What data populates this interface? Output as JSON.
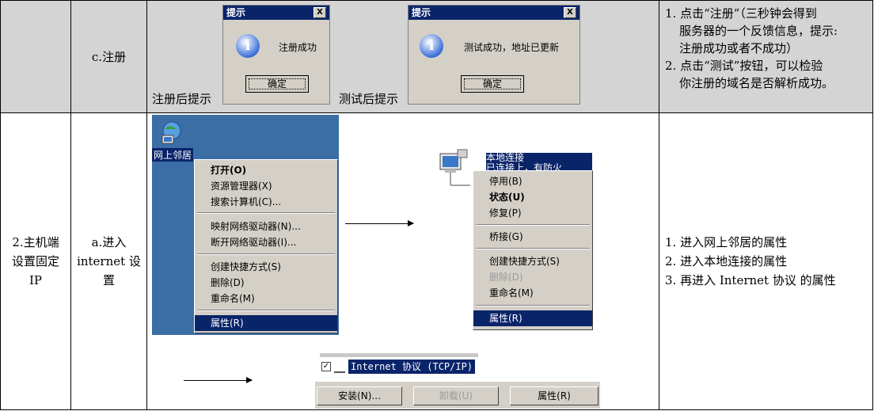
{
  "row1": {
    "step": "c.注册",
    "caption_register": "注册后提示",
    "caption_test": "测试后提示",
    "dialog1": {
      "title": "提示",
      "close": "X",
      "message": "注册成功",
      "ok": "确定"
    },
    "dialog2": {
      "title": "提示",
      "close": "X",
      "message": "测试成功，地址已更新",
      "ok": "确定"
    },
    "notes": [
      "1. 点击“注册”（三秒钟会得到",
      "服务器的一个反馈信息，提示:",
      "注册成功或者不成功）",
      "2. 点击“测试”按钮，可以检验",
      "你注册的域名是否解析成功。"
    ]
  },
  "row2": {
    "section_lines": [
      "2.主机端",
      "设置固定",
      "IP"
    ],
    "step_lines": [
      "a.进入",
      "internet 设",
      "置"
    ],
    "desktop_icon_label": "网上邻居",
    "menu1": [
      "打开(O)",
      "资源管理器(X)",
      "搜索计算机(C)...",
      "映射网络驱动器(N)...",
      "断开网络驱动器(I)...",
      "创建快捷方式(S)",
      "删除(D)",
      "重命名(M)",
      "属性(R)"
    ],
    "conn_label_1": "本地连接",
    "conn_label_2": "已连接上，有防火",
    "menu2": [
      "停用(B)",
      "状态(U)",
      "修复(P)",
      "桥接(G)",
      "创建快捷方式(S)",
      "删除(D)",
      "重命名(M)",
      "属性(R)"
    ],
    "protocol_item": "Internet 协议 (TCP/IP)",
    "protocol_buttons": [
      "安装(N)...",
      "卸载(U)",
      "属性(R)"
    ],
    "notes": [
      "1.  进入网上邻居的属性",
      "2.  进入本地连接的属性",
      "3.  再进入 Internet  协议  的属性"
    ]
  }
}
